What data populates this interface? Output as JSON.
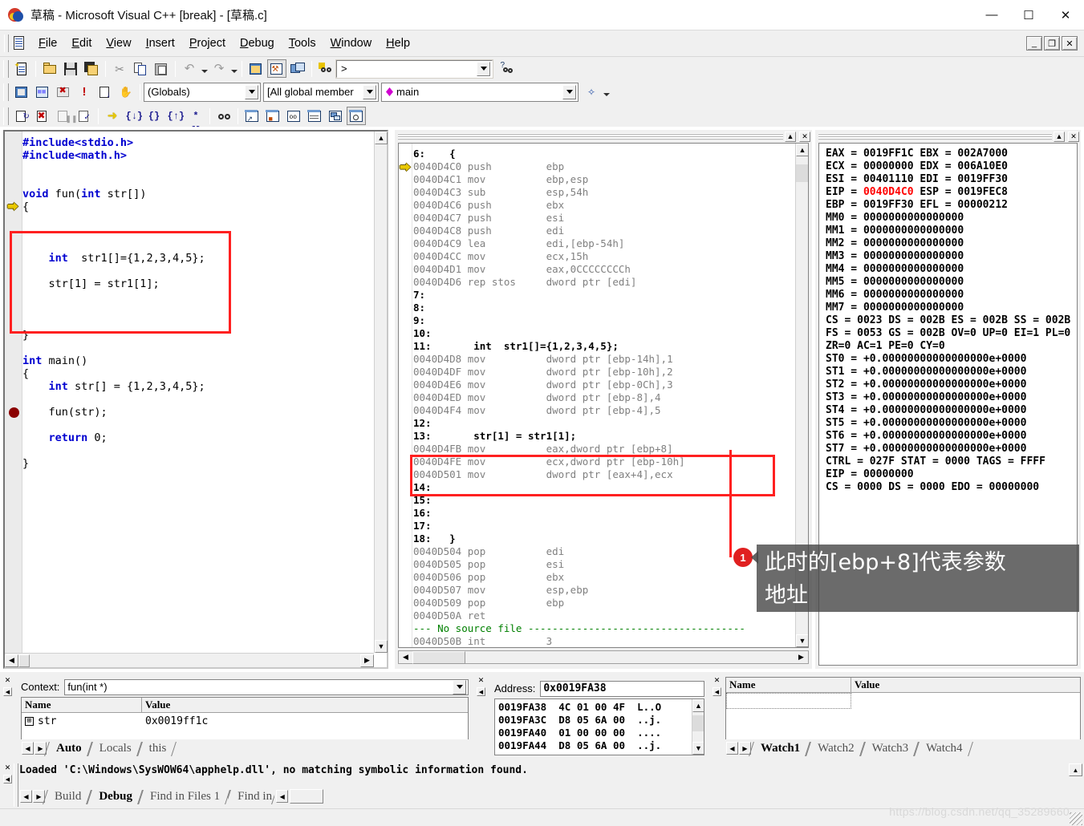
{
  "window": {
    "title": "草稿 - Microsoft Visual C++ [break] - [草稿.c]",
    "minimize": "—",
    "maximize": "☐",
    "close": "✕"
  },
  "menubar": {
    "items": [
      "File",
      "Edit",
      "View",
      "Insert",
      "Project",
      "Debug",
      "Tools",
      "Window",
      "Help"
    ],
    "mdi_restore": "_",
    "mdi_max": "❐",
    "mdi_close": "✕"
  },
  "toolbars": {
    "standard": {
      "find_placeholder": ">",
      "find_value": "",
      "buttons": [
        "new-file",
        "open-file",
        "save",
        "save-all",
        "cut",
        "copy",
        "paste",
        "undo",
        "redo",
        "workspace-window",
        "output-window",
        "window-list",
        "find-in-files"
      ]
    },
    "wizardbar": {
      "globals_combo": "(Globals)",
      "members_combo": "[All global member",
      "function_combo": "main",
      "buttons": [
        "compile",
        "build",
        "stop-build",
        "execute",
        "go",
        "insert-breakpoint"
      ]
    },
    "debug": {
      "buttons": [
        "restart",
        "stop-debugging",
        "break-execution",
        "apply-code-changes",
        "step-into",
        "step-over",
        "step-out",
        "run-to-cursor",
        "quick-watch",
        "watch-window",
        "variables-window",
        "registers-window",
        "memory-window",
        "call-stack-window",
        "disassembly-window"
      ]
    }
  },
  "source_editor": {
    "lines": [
      {
        "gutter": "",
        "text": "#include<stdio.h>",
        "style": "pp"
      },
      {
        "gutter": "",
        "text": "#include<math.h>",
        "style": "pp"
      },
      {
        "gutter": "",
        "text": "",
        "style": ""
      },
      {
        "gutter": "",
        "text": "",
        "style": ""
      },
      {
        "gutter": "",
        "text": "void fun(int str[])",
        "style": "code"
      },
      {
        "gutter": "arrow",
        "text": "{",
        "style": "code"
      },
      {
        "gutter": "",
        "text": "",
        "style": ""
      },
      {
        "gutter": "",
        "text": "",
        "style": ""
      },
      {
        "gutter": "",
        "text": "",
        "style": ""
      },
      {
        "gutter": "",
        "text": "    int  str1[]={1,2,3,4,5};",
        "style": "code"
      },
      {
        "gutter": "",
        "text": "",
        "style": ""
      },
      {
        "gutter": "",
        "text": "    str[1] = str1[1];",
        "style": "code"
      },
      {
        "gutter": "",
        "text": "",
        "style": ""
      },
      {
        "gutter": "",
        "text": "",
        "style": ""
      },
      {
        "gutter": "",
        "text": "",
        "style": ""
      },
      {
        "gutter": "",
        "text": "}",
        "style": "code"
      },
      {
        "gutter": "",
        "text": "",
        "style": ""
      },
      {
        "gutter": "",
        "text": "int main()",
        "style": "code"
      },
      {
        "gutter": "",
        "text": "{",
        "style": "code"
      },
      {
        "gutter": "",
        "text": "    int str[] = {1,2,3,4,5};",
        "style": "code"
      },
      {
        "gutter": "",
        "text": "",
        "style": ""
      },
      {
        "gutter": "breakpoint",
        "text": "    fun(str);",
        "style": "code"
      },
      {
        "gutter": "",
        "text": "",
        "style": ""
      },
      {
        "gutter": "",
        "text": "    return 0;",
        "style": "code"
      },
      {
        "gutter": "",
        "text": "",
        "style": ""
      },
      {
        "gutter": "",
        "text": "}",
        "style": "code"
      }
    ]
  },
  "disassembly": {
    "lines": [
      {
        "kind": "src",
        "text": "6:    {"
      },
      {
        "kind": "asm",
        "marker": "arrow",
        "addr": "0040D4C0",
        "op": "push",
        "args": "ebp"
      },
      {
        "kind": "asm",
        "addr": "0040D4C1",
        "op": "mov",
        "args": "ebp,esp"
      },
      {
        "kind": "asm",
        "addr": "0040D4C3",
        "op": "sub",
        "args": "esp,54h"
      },
      {
        "kind": "asm",
        "addr": "0040D4C6",
        "op": "push",
        "args": "ebx"
      },
      {
        "kind": "asm",
        "addr": "0040D4C7",
        "op": "push",
        "args": "esi"
      },
      {
        "kind": "asm",
        "addr": "0040D4C8",
        "op": "push",
        "args": "edi"
      },
      {
        "kind": "asm",
        "addr": "0040D4C9",
        "op": "lea",
        "args": "edi,[ebp-54h]"
      },
      {
        "kind": "asm",
        "addr": "0040D4CC",
        "op": "mov",
        "args": "ecx,15h"
      },
      {
        "kind": "asm",
        "addr": "0040D4D1",
        "op": "mov",
        "args": "eax,0CCCCCCCCh"
      },
      {
        "kind": "asm",
        "addr": "0040D4D6",
        "op": "rep stos",
        "args": "dword ptr [edi]"
      },
      {
        "kind": "src",
        "text": "7:"
      },
      {
        "kind": "src",
        "text": "8:"
      },
      {
        "kind": "src",
        "text": "9:"
      },
      {
        "kind": "src",
        "text": "10:"
      },
      {
        "kind": "src",
        "text": "11:       int  str1[]={1,2,3,4,5};"
      },
      {
        "kind": "asm",
        "addr": "0040D4D8",
        "op": "mov",
        "args": "dword ptr [ebp-14h],1"
      },
      {
        "kind": "asm",
        "addr": "0040D4DF",
        "op": "mov",
        "args": "dword ptr [ebp-10h],2"
      },
      {
        "kind": "asm",
        "addr": "0040D4E6",
        "op": "mov",
        "args": "dword ptr [ebp-0Ch],3"
      },
      {
        "kind": "asm",
        "addr": "0040D4ED",
        "op": "mov",
        "args": "dword ptr [ebp-8],4"
      },
      {
        "kind": "asm",
        "addr": "0040D4F4",
        "op": "mov",
        "args": "dword ptr [ebp-4],5"
      },
      {
        "kind": "src",
        "text": "12:"
      },
      {
        "kind": "src",
        "text": "13:       str[1] = str1[1];"
      },
      {
        "kind": "asm",
        "addr": "0040D4FB",
        "op": "mov",
        "args": "eax,dword ptr [ebp+8]"
      },
      {
        "kind": "asm",
        "addr": "0040D4FE",
        "op": "mov",
        "args": "ecx,dword ptr [ebp-10h]"
      },
      {
        "kind": "asm",
        "addr": "0040D501",
        "op": "mov",
        "args": "dword ptr [eax+4],ecx"
      },
      {
        "kind": "src",
        "text": "14:"
      },
      {
        "kind": "src",
        "text": "15:"
      },
      {
        "kind": "src",
        "text": "16:"
      },
      {
        "kind": "src",
        "text": "17:"
      },
      {
        "kind": "src",
        "text": "18:   }"
      },
      {
        "kind": "asm",
        "addr": "0040D504",
        "op": "pop",
        "args": "edi"
      },
      {
        "kind": "asm",
        "addr": "0040D505",
        "op": "pop",
        "args": "esi"
      },
      {
        "kind": "asm",
        "addr": "0040D506",
        "op": "pop",
        "args": "ebx"
      },
      {
        "kind": "asm",
        "addr": "0040D507",
        "op": "mov",
        "args": "esp,ebp"
      },
      {
        "kind": "asm",
        "addr": "0040D509",
        "op": "pop",
        "args": "ebp"
      },
      {
        "kind": "asm",
        "addr": "0040D50A",
        "op": "ret",
        "args": ""
      },
      {
        "kind": "nosrc",
        "text": "--- No source file ------------------------------------"
      },
      {
        "kind": "asm",
        "addr": "0040D50B",
        "op": "int",
        "args": "3"
      }
    ]
  },
  "registers": {
    "lines": [
      "EAX = 0019FF1C EBX = 002A7000",
      "ECX = 00000000 EDX = 006A10E0",
      "ESI = 00401110 EDI = 0019FF30",
      "EIP = 0040D4C0 ESP = 0019FEC8",
      "EBP = 0019FF30 EFL = 00000212",
      "MM0 = 0000000000000000",
      "MM1 = 0000000000000000",
      "MM2 = 0000000000000000",
      "MM3 = 0000000000000000",
      "MM4 = 0000000000000000",
      "MM5 = 0000000000000000",
      "MM6 = 0000000000000000",
      "MM7 = 0000000000000000",
      "CS = 0023 DS = 002B ES = 002B SS = 002B",
      "FS = 0053 GS = 002B OV=0 UP=0 EI=1 PL=0",
      "ZR=0 AC=1 PE=0 CY=0",
      "ST0 = +0.00000000000000000e+0000",
      "ST1 = +0.00000000000000000e+0000",
      "ST2 = +0.00000000000000000e+0000",
      "ST3 = +0.00000000000000000e+0000",
      "ST4 = +0.00000000000000000e+0000",
      "ST5 = +0.00000000000000000e+0000",
      "ST6 = +0.00000000000000000e+0000",
      "ST7 = +0.00000000000000000e+0000",
      "CTRL = 027F STAT = 0000 TAGS = FFFF",
      "EIP = 00000000",
      "CS = 0000 DS = 0000 EDO = 00000000"
    ],
    "eip_highlight": "0040D4C0",
    "eip_color": "#ff0000"
  },
  "annotation": {
    "badge": "1",
    "text": "此时的[ebp+8]代表参数\n地址"
  },
  "variables_pane": {
    "context_label": "Context:",
    "context_value": "fun(int *)",
    "columns": [
      "Name",
      "Value"
    ],
    "rows": [
      {
        "expander": "⊞",
        "name": "str",
        "value": "0x0019ff1c"
      }
    ],
    "tabs": [
      "Auto",
      "Locals",
      "this"
    ],
    "active_tab": "Auto"
  },
  "memory_pane": {
    "address_label": "Address:",
    "address_value": "0x0019FA38",
    "rows": [
      {
        "addr": "0019FA38",
        "bytes": "4C 01 00 4F",
        "ascii": "L..O"
      },
      {
        "addr": "0019FA3C",
        "bytes": "D8 05 6A 00",
        "ascii": "..j."
      },
      {
        "addr": "0019FA40",
        "bytes": "01 00 00 00",
        "ascii": "...."
      },
      {
        "addr": "0019FA44",
        "bytes": "D8 05 6A 00",
        "ascii": "..j."
      }
    ]
  },
  "watch_pane": {
    "columns": [
      "Name",
      "Value"
    ],
    "rows": [
      {
        "name": "",
        "value": ""
      }
    ],
    "tabs": [
      "Watch1",
      "Watch2",
      "Watch3",
      "Watch4"
    ],
    "active_tab": "Watch1"
  },
  "output_pane": {
    "text": "Loaded 'C:\\Windows\\SysWOW64\\apphelp.dll', no matching symbolic information found.",
    "tabs": [
      "Build",
      "Debug",
      "Find in Files 1",
      "Find in F"
    ],
    "active_tab": "Debug"
  },
  "watermark": "https://blog.csdn.net/qq_35289660"
}
